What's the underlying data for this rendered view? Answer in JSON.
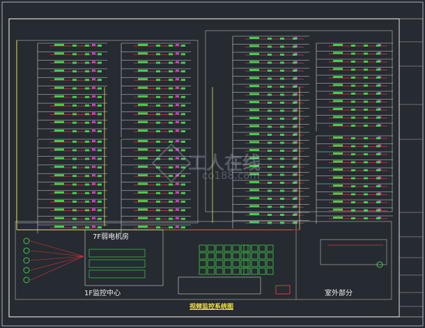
{
  "drawing": {
    "title": "视频监控系统图",
    "labels": {
      "weak_room": "7F弱电机房",
      "monitor_center": "1F监控中心",
      "outdoor": "室外部分"
    }
  },
  "watermark": {
    "brand_cn": "工人在线",
    "brand_en": "co188.com"
  },
  "colors": {
    "background": "#262a31",
    "border": "#ffffff",
    "trunk": "#e8e84a",
    "cable": "#e23b3b",
    "camera": "#3fd24a",
    "panel": "#d8d8d8",
    "accent": "#c43fd0",
    "rack": "#3fd24a"
  }
}
